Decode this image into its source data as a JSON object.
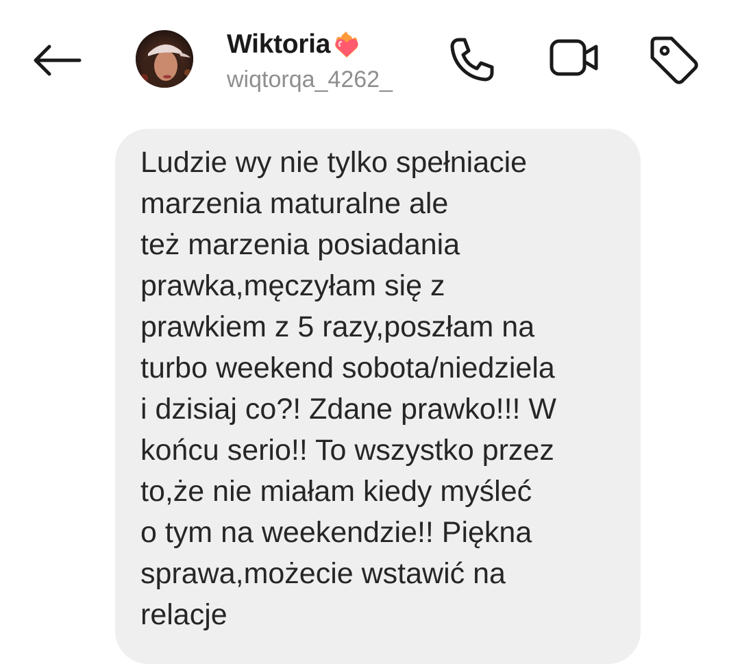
{
  "header": {
    "contact_name": "Wiktoria",
    "contact_username": "wiqtorqa_4262_",
    "icons": {
      "back": "arrow-left-icon",
      "avatar": "profile-avatar",
      "name_emoji": "burning-heart-icon",
      "call": "phone-icon",
      "video": "video-camera-icon",
      "tag": "tag-icon"
    }
  },
  "message": {
    "lines": [
      "Ludzie wy nie tylko spełniacie",
      "marzenia maturalne ale",
      "też marzenia posiadania",
      "prawka,męczyłam się z",
      "prawkiem z 5 razy,poszłam na",
      "turbo weekend sobota/niedziela",
      "i dzisiaj co?! Zdane prawko!!! W",
      "końcu serio!! To wszystko przez",
      "to,że nie miałam kiedy myśleć",
      "o tym na weekendzie!! Piękna",
      "sprawa,możecie wstawić na",
      "relacje"
    ]
  },
  "colors": {
    "background": "#ffffff",
    "bubble": "#efefef",
    "text": "#262626",
    "secondary_text": "#8e8e8e",
    "icon": "#1a1a1a"
  }
}
